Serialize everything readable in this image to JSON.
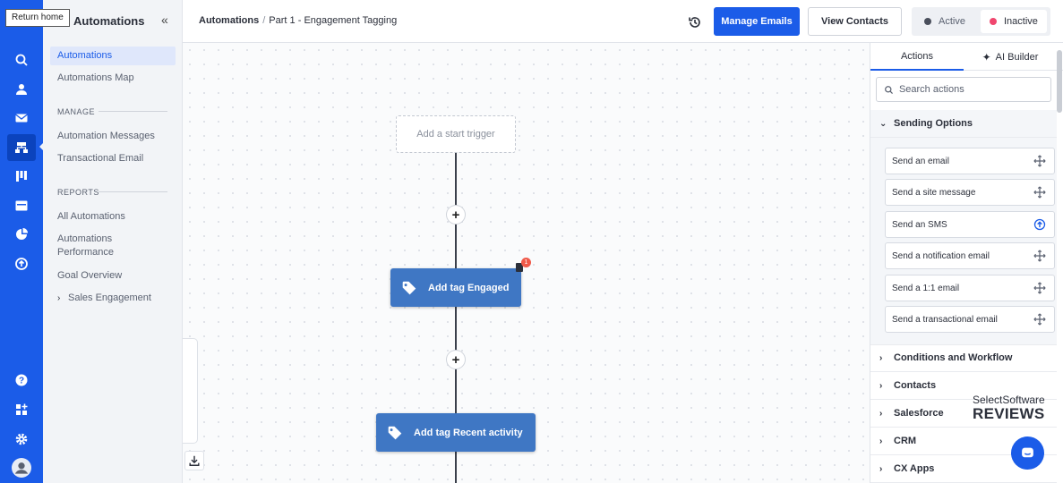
{
  "tooltip": "Return home",
  "rail": {
    "icons": [
      "home-icon",
      "search-icon",
      "contacts-icon",
      "campaigns-icon",
      "automations-icon",
      "deals-icon",
      "website-icon",
      "reports-icon",
      "apps-icon",
      "help-icon",
      "add-apps-icon",
      "settings-icon",
      "user-avatar-icon"
    ]
  },
  "subnav": {
    "title": "Automations",
    "items": [
      "Automations",
      "Automations Map"
    ],
    "manage_label": "MANAGE",
    "manage_items": [
      "Automation Messages",
      "Transactional Email"
    ],
    "reports_label": "REPORTS",
    "reports_items": [
      "All Automations",
      "Automations",
      "Performance",
      "Goal Overview",
      "Sales Engagement"
    ]
  },
  "header": {
    "crumb_root": "Automations",
    "crumb_sep": "/",
    "crumb_part": "Part 1 -",
    "crumb_name": "Engagement Tagging",
    "manage_emails": "Manage Emails",
    "view_contacts": "View Contacts",
    "active_label": "Active",
    "inactive_label": "Inactive",
    "active_color": "#4a4f5c",
    "inactive_color": "#f0466e"
  },
  "canvas": {
    "trigger_label": "Add a start trigger",
    "plus": "+",
    "node1_label": "Add tag Engaged",
    "node1_badge": "1",
    "node2_label": "Add tag Recent activity",
    "node_color": "#3f77c4"
  },
  "panel": {
    "tab_actions": "Actions",
    "tab_ai": "AI Builder",
    "search_placeholder": "Search actions",
    "sending_options": "Sending Options",
    "actions": [
      "Send an email",
      "Send a site message",
      "Send an SMS",
      "Send a notification email",
      "Send a 1:1 email",
      "Send a transactional email"
    ],
    "groups": [
      "Conditions and Workflow",
      "Contacts",
      "Salesforce",
      "CRM",
      "CX Apps"
    ]
  },
  "watermark": {
    "top": "SelectSoftware",
    "bottom": "REVIEWS"
  }
}
